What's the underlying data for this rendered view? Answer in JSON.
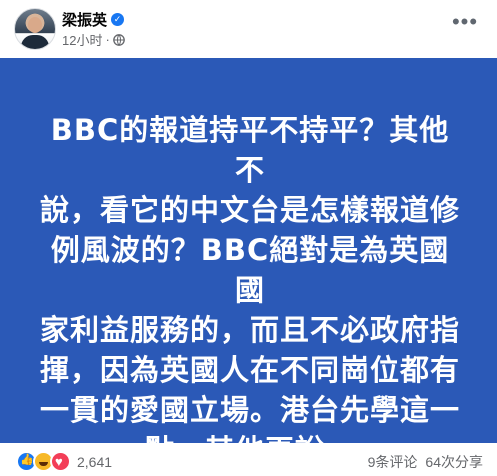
{
  "post": {
    "author": "梁振英",
    "timestamp": "12小时",
    "separator": "·",
    "privacy_icon": "globe-icon",
    "verified_icon": "verified-badge-icon",
    "more_icon": "more-options-icon",
    "text_lines": [
      "BBC的報道持平不持平？其他不",
      "說，看它的中文台是怎樣報道修",
      "例風波的？BBC絕對是為英國國",
      "家利益服務的，而且不必政府指",
      "揮，因為英國人在不同崗位都有",
      "一貫的愛國立場。港台先學這一",
      "點，其他再說。"
    ],
    "background_color": "#2b59b7"
  },
  "footer": {
    "reaction_icons": [
      "like-icon",
      "haha-icon",
      "love-icon"
    ],
    "reaction_count": "2,641",
    "comments": "9条评论",
    "shares": "64次分享"
  }
}
